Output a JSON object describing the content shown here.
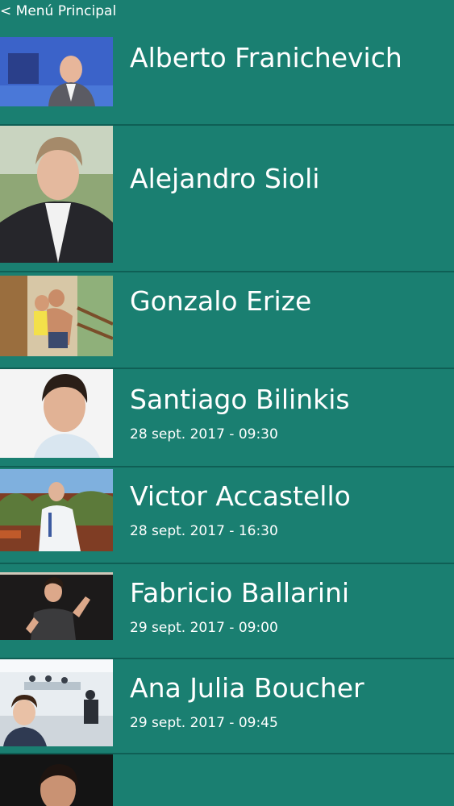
{
  "header": {
    "back_label": "< Menú Principal"
  },
  "speakers": [
    {
      "name": "Alberto Franichevich",
      "date": ""
    },
    {
      "name": "Alejandro Sioli",
      "date": ""
    },
    {
      "name": "Gonzalo Erize",
      "date": ""
    },
    {
      "name": "Santiago Bilinkis",
      "date": "28 sept. 2017 - 09:30"
    },
    {
      "name": "Victor Accastello",
      "date": "28 sept. 2017 - 16:30"
    },
    {
      "name": "Fabricio Ballarini",
      "date": "29 sept. 2017 - 09:00"
    },
    {
      "name": "Ana Julia Boucher",
      "date": "29 sept. 2017 - 09:45"
    },
    {
      "name": "",
      "date": ""
    }
  ]
}
